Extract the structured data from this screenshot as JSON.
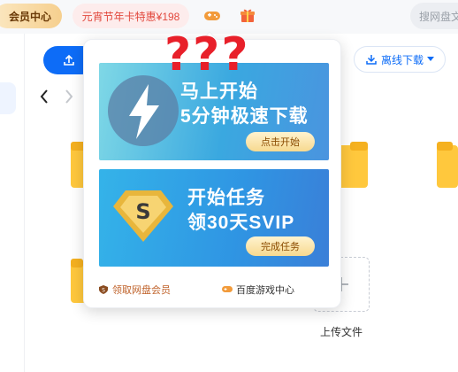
{
  "topbar": {
    "vip_label": "会员中心",
    "promo_label": "元宵节年卡特惠¥198",
    "search_placeholder": "搜网盘文"
  },
  "toolbar": {
    "offline_label": "离线下载"
  },
  "popover": {
    "card1": {
      "line1": "马上开始",
      "line2_num": "5分钟",
      "line2_text": "极速下载",
      "button": "点击开始"
    },
    "card2": {
      "line1": "开始任务",
      "line2_prefix": "领",
      "line2_num": "30天",
      "line2_suffix": "SVIP",
      "button": "完成任务"
    },
    "link_vip": "领取网盘会员",
    "link_game": "百度游戏中心"
  },
  "annotation": "???",
  "files": {
    "upload_label": "上传文件"
  },
  "colors": {
    "accent": "#0d6cf7",
    "promo": "#e2483d",
    "annotation": "#e8202a"
  }
}
